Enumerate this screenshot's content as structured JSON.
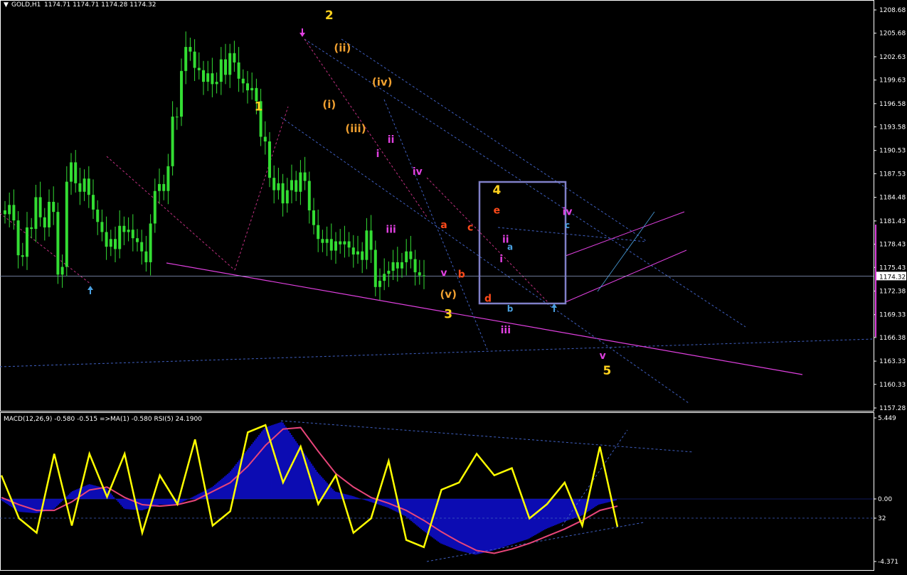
{
  "header": {
    "symbol_label": "GOLD,H1",
    "ohlc_label": "1174.71 1174.71 1174.28 1174.32",
    "indicator_label": "MACD(12,26,9) -0.580 -0.515  =>MA(1) -0.580  RSI(5) 24.1900"
  },
  "colors": {
    "background": "#000000",
    "candles": "#33dd33",
    "wave_yellow": "#ffd21e",
    "wave_orange": "#f0a030",
    "wave_magenta": "#e040e0",
    "wave_red": "#ff4a1a",
    "wave_blue": "#4aa0e0",
    "trend_line": "#e040e0",
    "channel_line": "#3f5fc0",
    "macd_fill": "#1010e0",
    "signal_line": "#e8457a",
    "rsi_line": "#ffff00",
    "box": "#8080c8",
    "price_marker": "#e040e0"
  },
  "chart_data": [
    {
      "type": "candlestick",
      "title": "GOLD,H1",
      "ylim": [
        1157.28,
        1208.68
      ],
      "y_ticks": [
        "1208.68",
        "1205.68",
        "1202.63",
        "1199.63",
        "1196.58",
        "1193.58",
        "1190.53",
        "1187.53",
        "1184.48",
        "1181.43",
        "1178.43",
        "1175.43",
        "1172.38",
        "1169.33",
        "1166.38",
        "1163.33",
        "1160.33",
        "1157.28"
      ],
      "current_price": "1174.32",
      "close_path": [
        1182.3,
        1183.5,
        1181.5,
        1177.0,
        1176.8,
        1180.6,
        1180.4,
        1184.5,
        1181.9,
        1180.6,
        1183.9,
        1182.6,
        1174.5,
        1175.5,
        1186.5,
        1189.0,
        1186.3,
        1185.2,
        1186.9,
        1184.8,
        1182.9,
        1181.3,
        1180.0,
        1178.1,
        1179.1,
        1177.8,
        1180.8,
        1180.0,
        1180.3,
        1179.2,
        1178.7,
        1177.5,
        1176.1,
        1181.1,
        1185.3,
        1186.2,
        1185.3,
        1188.5,
        1194.9,
        1194.9,
        1200.8,
        1203.9,
        1203.3,
        1201.2,
        1200.9,
        1199.4,
        1200.5,
        1199.1,
        1199.4,
        1202.3,
        1200.3,
        1203.1,
        1201.9,
        1199.8,
        1199.2,
        1198.3,
        1198.6,
        1196.9,
        1192.3,
        1191.7,
        1187.0,
        1185.4,
        1186.3,
        1183.7,
        1185.4,
        1186.7,
        1185.2,
        1187.7,
        1186.6,
        1182.8,
        1180.9,
        1179.1,
        1178.6,
        1179.1,
        1177.6,
        1178.8,
        1178.4,
        1178.8,
        1178.0,
        1177.1,
        1177.5,
        1176.4,
        1180.2,
        1177.7,
        1172.9,
        1173.7,
        1174.6,
        1175.0,
        1176.1,
        1175.3,
        1176.1,
        1177.5,
        1176.5,
        1174.8,
        1174.4,
        1174.32
      ],
      "waves": [
        {
          "label": "1",
          "color": "wave_yellow",
          "bar": 58,
          "price": 1195.7
        },
        {
          "label": "2",
          "color": "wave_yellow",
          "bar": 74,
          "price": 1207.5
        },
        {
          "label": "(ii)",
          "color": "wave_orange",
          "bar": 77,
          "price": 1203.3
        },
        {
          "label": "(i)",
          "color": "wave_orange",
          "bar": 74,
          "price": 1196.0
        },
        {
          "label": "(iv)",
          "color": "wave_orange",
          "bar": 86,
          "price": 1198.9
        },
        {
          "label": "(iii)",
          "color": "wave_orange",
          "bar": 80,
          "price": 1192.9
        },
        {
          "label": "ii",
          "color": "wave_magenta",
          "bar": 88,
          "price": 1191.5
        },
        {
          "label": "i",
          "color": "wave_magenta",
          "bar": 85,
          "price": 1189.7
        },
        {
          "label": "iv",
          "color": "wave_magenta",
          "bar": 94,
          "price": 1187.4
        },
        {
          "label": "iii",
          "color": "wave_magenta",
          "bar": 88,
          "price": 1179.9
        },
        {
          "label": "a",
          "color": "wave_red",
          "bar": 100,
          "price": 1180.5
        },
        {
          "label": "c",
          "color": "wave_red",
          "bar": 106,
          "price": 1180.2
        },
        {
          "label": "e",
          "color": "wave_red",
          "bar": 112,
          "price": 1182.4
        },
        {
          "label": "4",
          "color": "wave_yellow",
          "bar": 112,
          "price": 1184.9
        },
        {
          "label": "v",
          "color": "wave_magenta",
          "bar": 100,
          "price": 1174.3
        },
        {
          "label": "b",
          "color": "wave_red",
          "bar": 104,
          "price": 1174.1
        },
        {
          "label": "(v)",
          "color": "wave_orange",
          "bar": 101,
          "price": 1171.5
        },
        {
          "label": "d",
          "color": "wave_red",
          "bar": 110,
          "price": 1171.0
        },
        {
          "label": "3",
          "color": "wave_yellow",
          "bar": 101,
          "price": 1168.9
        },
        {
          "label": "ii",
          "color": "wave_magenta",
          "bar": 114,
          "price": 1178.6
        },
        {
          "label": "a",
          "color": "wave_blue",
          "bar": 115,
          "price": 1177.7
        },
        {
          "label": "i",
          "color": "wave_magenta",
          "bar": 113,
          "price": 1176.1
        },
        {
          "label": "b",
          "color": "wave_blue",
          "bar": 115,
          "price": 1169.7
        },
        {
          "label": "iii",
          "color": "wave_magenta",
          "bar": 114,
          "price": 1166.9
        },
        {
          "label": "iv",
          "color": "wave_magenta",
          "bar": 128,
          "price": 1182.2
        },
        {
          "label": "c",
          "color": "wave_blue",
          "bar": 128,
          "price": 1180.5
        },
        {
          "label": "v",
          "color": "wave_magenta",
          "bar": 136,
          "price": 1163.6
        },
        {
          "label": "5",
          "color": "wave_yellow",
          "bar": 137,
          "price": 1161.6
        }
      ]
    },
    {
      "type": "line",
      "title": "MACD(12,26,9) -0.580 -0.515  =>MA(1) -0.580  RSI(5) 24.1900",
      "ylim": [
        -4.371,
        5.449
      ],
      "y_ticks": [
        "5.449",
        "0.00",
        "32",
        "-4.371"
      ],
      "series": [
        {
          "name": "MACD",
          "type": "area",
          "values": [
            -0.1,
            -0.9,
            -1.0,
            -0.7,
            0.5,
            1.0,
            0.7,
            -0.7,
            -0.8,
            -0.4,
            -0.4,
            0.2,
            0.8,
            1.8,
            3.3,
            4.8,
            5.2,
            3.5,
            1.8,
            0.5,
            0.2,
            -0.2,
            -0.6,
            -1.2,
            -2.2,
            -3.1,
            -3.6,
            -3.9,
            -3.6,
            -3.2,
            -2.8,
            -2.1,
            -1.6,
            -1.2,
            -0.4,
            -0.1
          ]
        },
        {
          "name": "Signal",
          "type": "line",
          "values": [
            0.1,
            -0.4,
            -0.8,
            -0.8,
            -0.2,
            0.6,
            0.8,
            0.1,
            -0.4,
            -0.5,
            -0.4,
            -0.1,
            0.5,
            1.1,
            2.2,
            3.6,
            4.7,
            4.8,
            3.2,
            1.7,
            0.8,
            0.1,
            -0.3,
            -0.8,
            -1.5,
            -2.3,
            -3.0,
            -3.6,
            -3.8,
            -3.5,
            -3.1,
            -2.6,
            -2.1,
            -1.5,
            -0.8,
            -0.5
          ]
        },
        {
          "name": "RSI",
          "type": "line",
          "values": [
            60,
            30,
            20,
            75,
            25,
            75,
            45,
            75,
            20,
            60,
            40,
            85,
            25,
            35,
            90,
            95,
            55,
            80,
            40,
            60,
            20,
            30,
            70,
            15,
            10,
            50,
            55,
            75,
            60,
            65,
            30,
            40,
            55,
            25,
            80,
            24.19
          ]
        }
      ]
    }
  ]
}
